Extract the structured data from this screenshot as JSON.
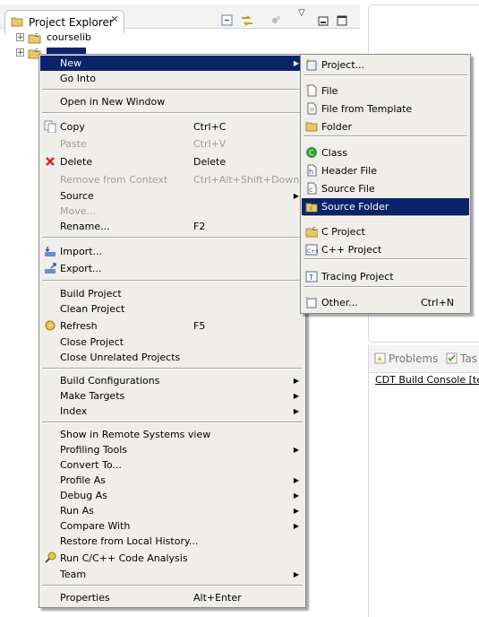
{
  "explorer": {
    "tab_title": "Project Explorer",
    "tab_close_glyph": "✕",
    "tree": [
      {
        "label": "courselib",
        "expander": "+",
        "icon": "c-project-icon",
        "selected": false
      },
      {
        "label": "",
        "expander": "+",
        "icon": "c-project-icon",
        "selected": true
      }
    ]
  },
  "console": {
    "tabs": [
      "Problems",
      "Tas"
    ],
    "title": "CDT Build Console [test_"
  },
  "context_menu": {
    "items": [
      {
        "label": "New",
        "accel": "",
        "submenu": true,
        "disabled": false,
        "highlighted": true,
        "icon": ""
      },
      {
        "label": "Go Into",
        "accel": "",
        "submenu": false,
        "disabled": false,
        "highlighted": false,
        "icon": ""
      },
      {
        "sep": true
      },
      {
        "label": "Open in New Window",
        "accel": "",
        "submenu": false,
        "disabled": false,
        "highlighted": false,
        "icon": ""
      },
      {
        "sep": true
      },
      {
        "label": "Copy",
        "accel": "Ctrl+C",
        "submenu": false,
        "disabled": false,
        "highlighted": false,
        "icon": "copy-icon"
      },
      {
        "label": "Paste",
        "accel": "Ctrl+V",
        "submenu": false,
        "disabled": true,
        "highlighted": false,
        "icon": ""
      },
      {
        "label": "Delete",
        "accel": "Delete",
        "submenu": false,
        "disabled": false,
        "highlighted": false,
        "icon": "delete-icon"
      },
      {
        "label": "Remove from Context",
        "accel": "Ctrl+Alt+Shift+Down",
        "submenu": false,
        "disabled": true,
        "highlighted": false,
        "icon": ""
      },
      {
        "label": "Source",
        "accel": "",
        "submenu": true,
        "disabled": false,
        "highlighted": false,
        "icon": ""
      },
      {
        "label": "Move...",
        "accel": "",
        "submenu": false,
        "disabled": true,
        "highlighted": false,
        "icon": ""
      },
      {
        "label": "Rename...",
        "accel": "F2",
        "submenu": false,
        "disabled": false,
        "highlighted": false,
        "icon": ""
      },
      {
        "sep": true
      },
      {
        "label": "Import...",
        "accel": "",
        "submenu": false,
        "disabled": false,
        "highlighted": false,
        "icon": "import-icon"
      },
      {
        "label": "Export...",
        "accel": "",
        "submenu": false,
        "disabled": false,
        "highlighted": false,
        "icon": "export-icon"
      },
      {
        "sep": true
      },
      {
        "label": "Build Project",
        "accel": "",
        "submenu": false,
        "disabled": false,
        "highlighted": false,
        "icon": ""
      },
      {
        "label": "Clean Project",
        "accel": "",
        "submenu": false,
        "disabled": false,
        "highlighted": false,
        "icon": ""
      },
      {
        "label": "Refresh",
        "accel": "F5",
        "submenu": false,
        "disabled": false,
        "highlighted": false,
        "icon": "refresh-icon"
      },
      {
        "label": "Close Project",
        "accel": "",
        "submenu": false,
        "disabled": false,
        "highlighted": false,
        "icon": ""
      },
      {
        "label": "Close Unrelated Projects",
        "accel": "",
        "submenu": false,
        "disabled": false,
        "highlighted": false,
        "icon": ""
      },
      {
        "sep": true
      },
      {
        "label": "Build Configurations",
        "accel": "",
        "submenu": true,
        "disabled": false,
        "highlighted": false,
        "icon": ""
      },
      {
        "label": "Make Targets",
        "accel": "",
        "submenu": true,
        "disabled": false,
        "highlighted": false,
        "icon": ""
      },
      {
        "label": "Index",
        "accel": "",
        "submenu": true,
        "disabled": false,
        "highlighted": false,
        "icon": ""
      },
      {
        "sep": true
      },
      {
        "label": "Show in Remote Systems view",
        "accel": "",
        "submenu": false,
        "disabled": false,
        "highlighted": false,
        "icon": ""
      },
      {
        "label": "Profiling Tools",
        "accel": "",
        "submenu": true,
        "disabled": false,
        "highlighted": false,
        "icon": ""
      },
      {
        "label": "Convert To...",
        "accel": "",
        "submenu": false,
        "disabled": false,
        "highlighted": false,
        "icon": ""
      },
      {
        "label": "Profile As",
        "accel": "",
        "submenu": true,
        "disabled": false,
        "highlighted": false,
        "icon": ""
      },
      {
        "label": "Debug As",
        "accel": "",
        "submenu": true,
        "disabled": false,
        "highlighted": false,
        "icon": ""
      },
      {
        "label": "Run As",
        "accel": "",
        "submenu": true,
        "disabled": false,
        "highlighted": false,
        "icon": ""
      },
      {
        "label": "Compare With",
        "accel": "",
        "submenu": true,
        "disabled": false,
        "highlighted": false,
        "icon": ""
      },
      {
        "label": "Restore from Local History...",
        "accel": "",
        "submenu": false,
        "disabled": false,
        "highlighted": false,
        "icon": ""
      },
      {
        "label": "Run C/C++ Code Analysis",
        "accel": "",
        "submenu": false,
        "disabled": false,
        "highlighted": false,
        "icon": "code-analysis-icon"
      },
      {
        "label": "Team",
        "accel": "",
        "submenu": true,
        "disabled": false,
        "highlighted": false,
        "icon": ""
      },
      {
        "sep": true
      },
      {
        "label": "Properties",
        "accel": "Alt+Enter",
        "submenu": false,
        "disabled": false,
        "highlighted": false,
        "icon": ""
      }
    ]
  },
  "new_submenu": {
    "items": [
      {
        "label": "Project...",
        "accel": "",
        "highlighted": false,
        "icon": "new-project-icon"
      },
      {
        "sep": true
      },
      {
        "label": "File",
        "accel": "",
        "highlighted": false,
        "icon": "new-file-icon"
      },
      {
        "label": "File from Template",
        "accel": "",
        "highlighted": false,
        "icon": "file-template-icon"
      },
      {
        "label": "Folder",
        "accel": "",
        "highlighted": false,
        "icon": "folder-icon"
      },
      {
        "sep": true
      },
      {
        "label": "Class",
        "accel": "",
        "highlighted": false,
        "icon": "class-icon"
      },
      {
        "label": "Header File",
        "accel": "",
        "highlighted": false,
        "icon": "header-file-icon"
      },
      {
        "label": "Source File",
        "accel": "",
        "highlighted": false,
        "icon": "source-file-icon"
      },
      {
        "label": "Source Folder",
        "accel": "",
        "highlighted": true,
        "icon": "source-folder-icon"
      },
      {
        "sep": true
      },
      {
        "label": "C Project",
        "accel": "",
        "highlighted": false,
        "icon": "c-project-icon"
      },
      {
        "label": "C++ Project",
        "accel": "",
        "highlighted": false,
        "icon": "cpp-project-icon"
      },
      {
        "sep": true
      },
      {
        "label": "Tracing Project",
        "accel": "",
        "highlighted": false,
        "icon": "tracing-project-icon"
      },
      {
        "sep": true
      },
      {
        "label": "Other...",
        "accel": "Ctrl+N",
        "highlighted": false,
        "icon": "other-wizard-icon"
      }
    ]
  },
  "colors": {
    "selection": "#0a246a",
    "menu_bg": "#f0eeea",
    "disabled_text": "#9d9d9d"
  }
}
